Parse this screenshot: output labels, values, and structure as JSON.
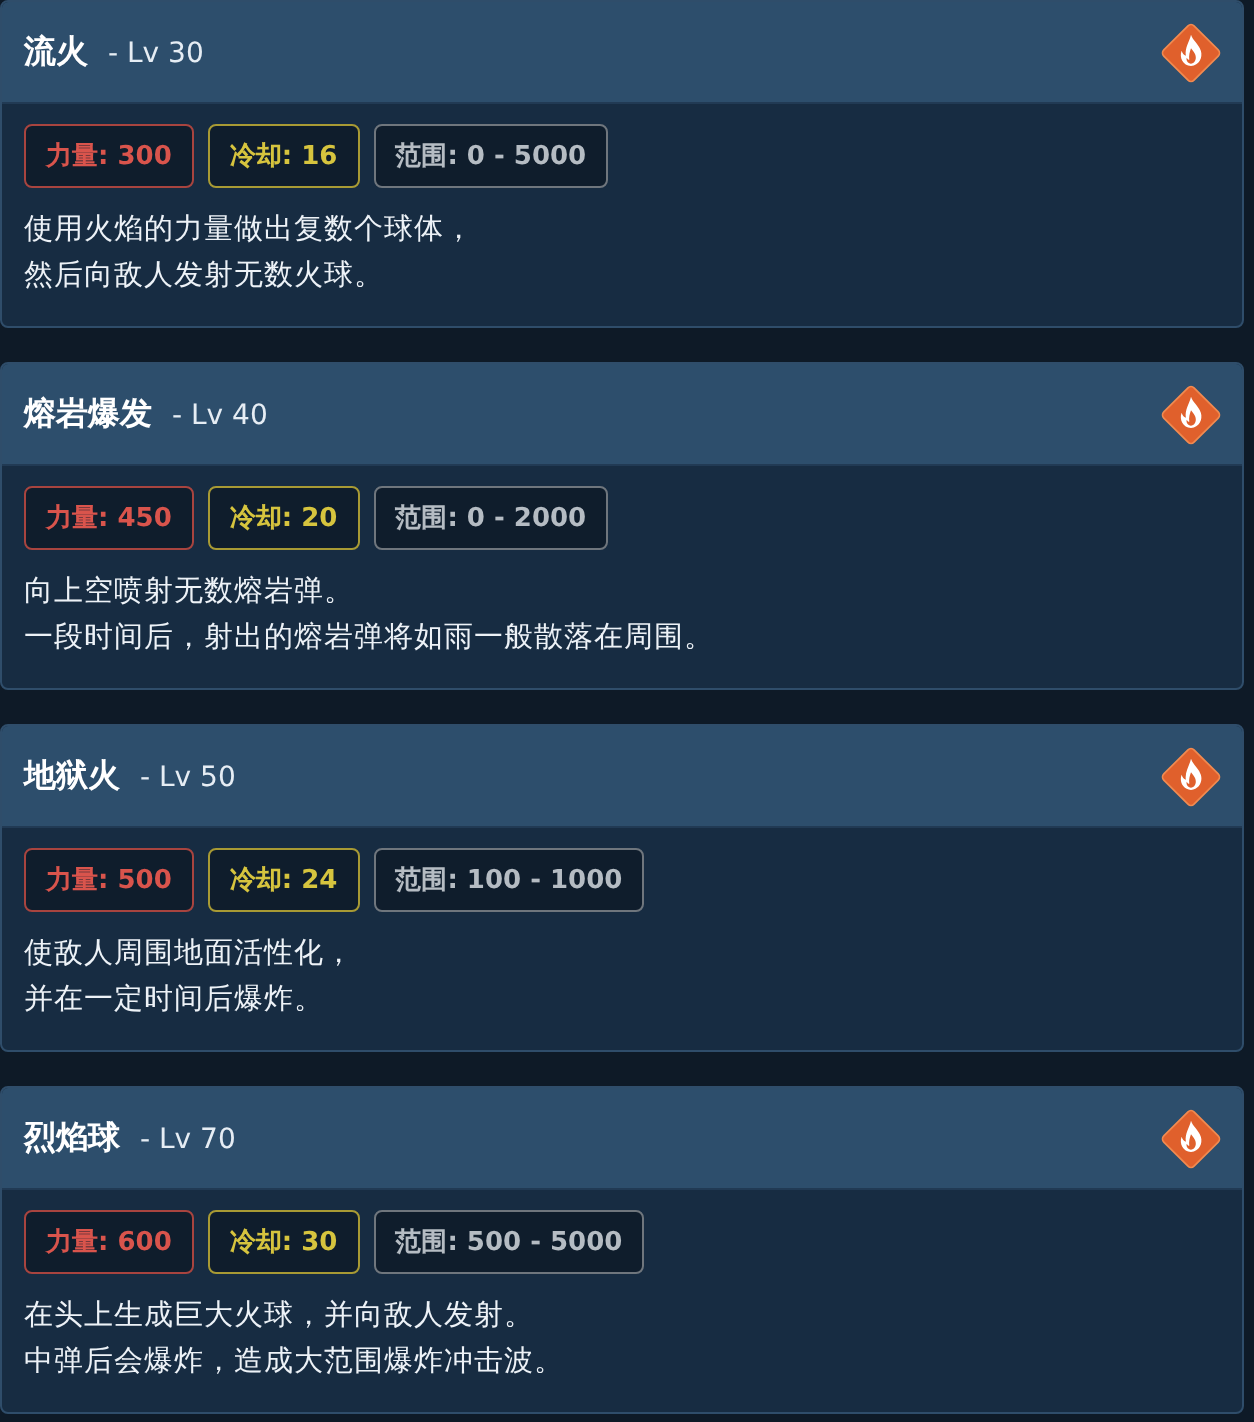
{
  "skills": [
    {
      "name": "流火",
      "level": "- Lv 30",
      "stats": [
        {
          "kind": "power",
          "text": "力量: 300"
        },
        {
          "kind": "cooldown",
          "text": "冷却: 16"
        },
        {
          "kind": "range",
          "text": "范围: 0 - 5000"
        }
      ],
      "description": [
        "使用火焰的力量做出复数个球体，",
        "然后向敌人发射无数火球。"
      ]
    },
    {
      "name": "熔岩爆发",
      "level": "- Lv 40",
      "stats": [
        {
          "kind": "power",
          "text": "力量: 450"
        },
        {
          "kind": "cooldown",
          "text": "冷却: 20"
        },
        {
          "kind": "range",
          "text": "范围: 0 - 2000"
        }
      ],
      "description": [
        "向上空喷射无数熔岩弹。",
        "一段时间后，射出的熔岩弹将如雨一般散落在周围。"
      ]
    },
    {
      "name": "地狱火",
      "level": "- Lv 50",
      "stats": [
        {
          "kind": "power",
          "text": "力量: 500"
        },
        {
          "kind": "cooldown",
          "text": "冷却: 24"
        },
        {
          "kind": "range",
          "text": "范围: 100 - 1000"
        }
      ],
      "description": [
        "使敌人周围地面活性化，",
        "并在一定时间后爆炸。"
      ]
    },
    {
      "name": "烈焰球",
      "level": "- Lv 70",
      "stats": [
        {
          "kind": "power",
          "text": "力量: 600"
        },
        {
          "kind": "cooldown",
          "text": "冷却: 30"
        },
        {
          "kind": "range",
          "text": "范围: 500 - 5000"
        }
      ],
      "description": [
        "在头上生成巨大火球，并向敌人发射。",
        "中弹后会爆炸，造成大范围爆炸冲击波。"
      ]
    }
  ]
}
